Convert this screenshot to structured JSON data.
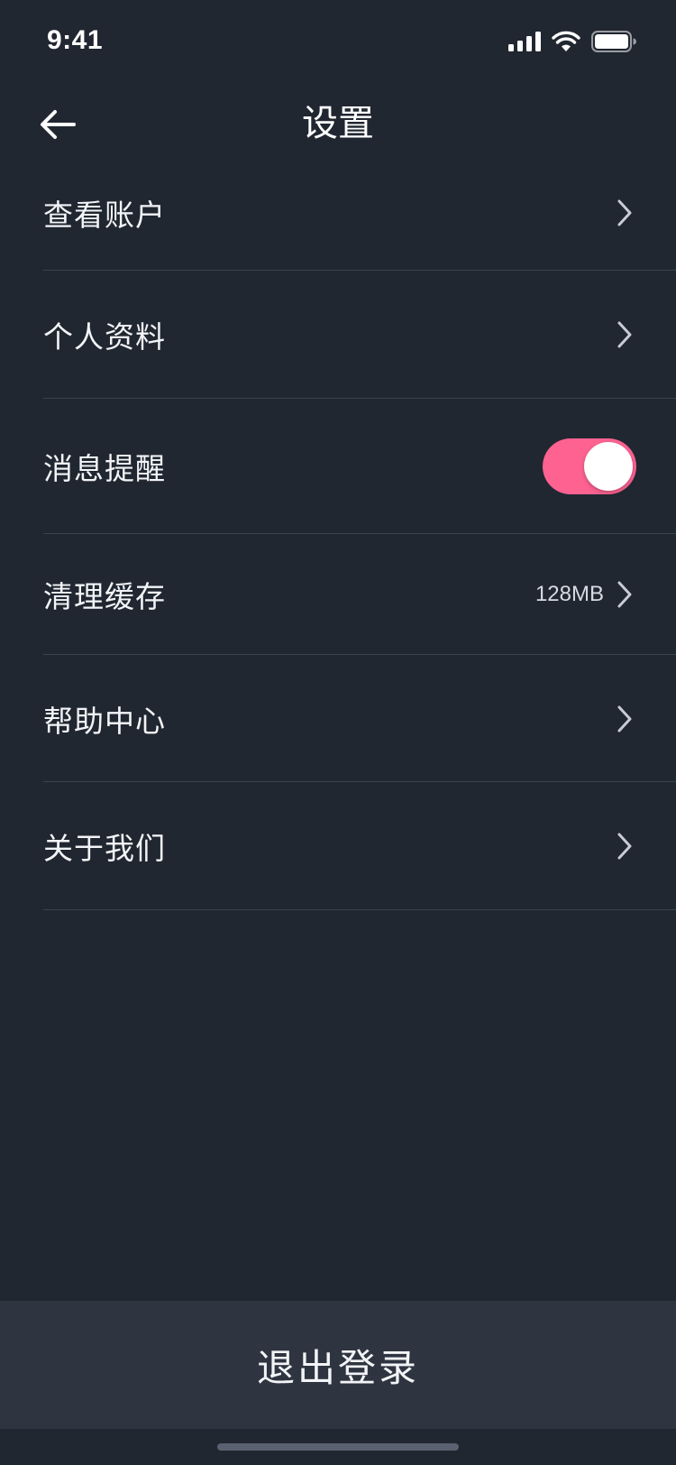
{
  "status_bar": {
    "time": "9:41",
    "icons": [
      "signal-icon",
      "wifi-icon",
      "battery-icon"
    ]
  },
  "header": {
    "title": "设置",
    "back_icon": "arrow-left-icon"
  },
  "settings": {
    "items": [
      {
        "key": "view-account",
        "label": "查看账户",
        "value": "",
        "type": "link"
      },
      {
        "key": "profile",
        "label": "个人资料",
        "value": "",
        "type": "link"
      },
      {
        "key": "notifications",
        "label": "消息提醒",
        "value": "",
        "type": "toggle",
        "on": true
      },
      {
        "key": "clear-cache",
        "label": "清理缓存",
        "value": "128MB",
        "type": "link"
      },
      {
        "key": "help-center",
        "label": "帮助中心",
        "value": "",
        "type": "link"
      },
      {
        "key": "about-us",
        "label": "关于我们",
        "value": "",
        "type": "link"
      }
    ]
  },
  "logout": {
    "label": "退出登录"
  },
  "colors": {
    "background": "#212731",
    "logout_background": "#2f3540",
    "toggle_on": "#fd6291",
    "divider": "#3a4350"
  }
}
